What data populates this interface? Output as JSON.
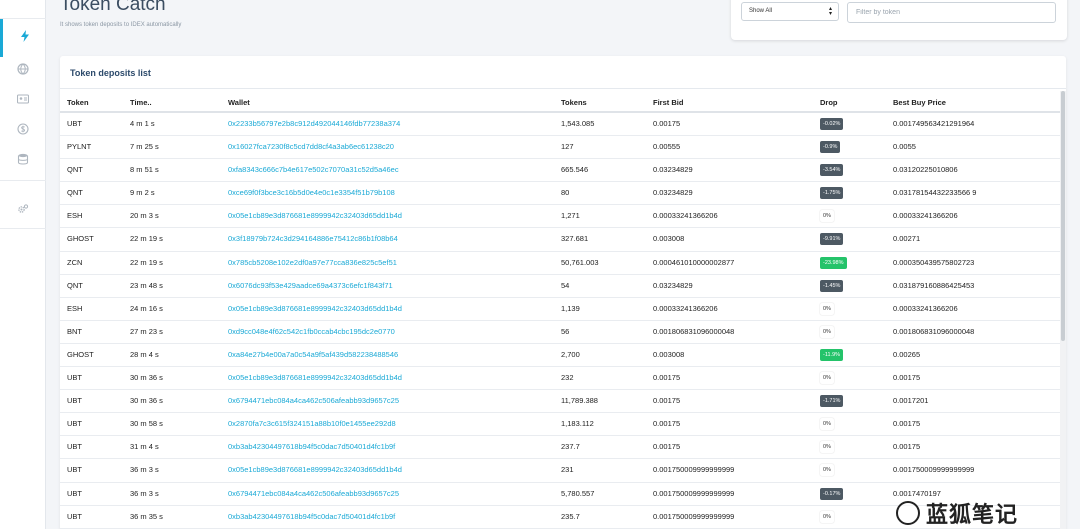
{
  "header": {
    "title": "Token Catch",
    "subtitle": "It shows token deposits to IDEX automatically"
  },
  "sidebar": {
    "items": [
      {
        "icon": "lightning-icon",
        "active": true
      },
      {
        "icon": "globe-icon",
        "active": false
      },
      {
        "icon": "id-card-icon",
        "active": false
      },
      {
        "icon": "dollar-circle-icon",
        "active": false
      },
      {
        "icon": "database-icon",
        "active": false
      },
      {
        "icon": "settings-icon",
        "active": false
      }
    ]
  },
  "filters": {
    "select_value": "Show All",
    "filter_placeholder": "Filter by token"
  },
  "card": {
    "title": "Token deposits list"
  },
  "table": {
    "columns": [
      "Token",
      "Time..",
      "Wallet",
      "Tokens",
      "First Bid",
      "Drop",
      "Best Buy Price"
    ],
    "rows": [
      {
        "token": "UBT",
        "time": "4 m 1 s",
        "wallet": "0x2233b56797e2b8c912d492044146fdb77238a374",
        "tokens": "1,543.085",
        "first_bid": "0.00175",
        "drop": "-0.02%",
        "drop_style": "dark",
        "best_buy": "0.001749563421291964"
      },
      {
        "token": "PYLNT",
        "time": "7 m 25 s",
        "wallet": "0x16027fca7230f8c5cd7dd8cf4a3ab6ec61238c20",
        "tokens": "127",
        "first_bid": "0.00555",
        "drop": "-0.9%",
        "drop_style": "dark",
        "best_buy": "0.0055"
      },
      {
        "token": "QNT",
        "time": "8 m 51 s",
        "wallet": "0xfa8343c666c7b4e617e502c7070a31c52d5a46ec",
        "tokens": "665.546",
        "first_bid": "0.03234829",
        "drop": "-3.54%",
        "drop_style": "dark",
        "best_buy": "0.03120225010806"
      },
      {
        "token": "QNT",
        "time": "9 m 2 s",
        "wallet": "0xce69f0f3bce3c16b5d0e4e0c1e3354f51b79b108",
        "tokens": "80",
        "first_bid": "0.03234829",
        "drop": "-1.75%",
        "drop_style": "dark",
        "best_buy": "0.03178154432233566 9"
      },
      {
        "token": "ESH",
        "time": "20 m 3 s",
        "wallet": "0x05e1cb89e3d876681e8999942c32403d65dd1b4d",
        "tokens": "1,271",
        "first_bid": "0.00033241366206",
        "drop": "0%",
        "drop_style": "plain",
        "best_buy": "0.00033241366206"
      },
      {
        "token": "GHOST",
        "time": "22 m 19 s",
        "wallet": "0x3f18979b724c3d294164886e75412c86b1f08b64",
        "tokens": "327.681",
        "first_bid": "0.003008",
        "drop": "-9.91%",
        "drop_style": "dark",
        "best_buy": "0.00271"
      },
      {
        "token": "ZCN",
        "time": "22 m 19 s",
        "wallet": "0x785cb5208e102e2df0a97e77cca836e825c5ef51",
        "tokens": "50,761.003",
        "first_bid": "0.000461010000002877",
        "drop": "-23.98%",
        "drop_style": "green",
        "best_buy": "0.000350439575802723"
      },
      {
        "token": "QNT",
        "time": "23 m 48 s",
        "wallet": "0x6076dc93f53e429aadce69a4373c6efc1f843f71",
        "tokens": "54",
        "first_bid": "0.03234829",
        "drop": "-1.45%",
        "drop_style": "dark",
        "best_buy": "0.031879160886425453"
      },
      {
        "token": "ESH",
        "time": "24 m 16 s",
        "wallet": "0x05e1cb89e3d876681e8999942c32403d65dd1b4d",
        "tokens": "1,139",
        "first_bid": "0.00033241366206",
        "drop": "0%",
        "drop_style": "plain",
        "best_buy": "0.00033241366206"
      },
      {
        "token": "BNT",
        "time": "27 m 23 s",
        "wallet": "0xd9cc048e4f62c542c1fb0ccab4cbc195dc2e0770",
        "tokens": "56",
        "first_bid": "0.001806831096000048",
        "drop": "0%",
        "drop_style": "plain",
        "best_buy": "0.001806831096000048"
      },
      {
        "token": "GHOST",
        "time": "28 m 4 s",
        "wallet": "0xa84e27b4e00a7a0c54a9f5af439d582238488546",
        "tokens": "2,700",
        "first_bid": "0.003008",
        "drop": "-11.9%",
        "drop_style": "green",
        "best_buy": "0.00265"
      },
      {
        "token": "UBT",
        "time": "30 m 36 s",
        "wallet": "0x05e1cb89e3d876681e8999942c32403d65dd1b4d",
        "tokens": "232",
        "first_bid": "0.00175",
        "drop": "0%",
        "drop_style": "plain",
        "best_buy": "0.00175"
      },
      {
        "token": "UBT",
        "time": "30 m 36 s",
        "wallet": "0x6794471ebc084a4ca462c506afeabb93d9657c25",
        "tokens": "11,789.388",
        "first_bid": "0.00175",
        "drop": "-1.71%",
        "drop_style": "dark",
        "best_buy": "0.0017201"
      },
      {
        "token": "UBT",
        "time": "30 m 58 s",
        "wallet": "0x2870fa7c3c615f324151a88b10f0e1455ee292d8",
        "tokens": "1,183.112",
        "first_bid": "0.00175",
        "drop": "0%",
        "drop_style": "plain",
        "best_buy": "0.00175"
      },
      {
        "token": "UBT",
        "time": "31 m 4 s",
        "wallet": "0xb3ab42304497618b94f5c0dac7d50401d4fc1b9f",
        "tokens": "237.7",
        "first_bid": "0.00175",
        "drop": "0%",
        "drop_style": "plain",
        "best_buy": "0.00175"
      },
      {
        "token": "UBT",
        "time": "36 m 3 s",
        "wallet": "0x05e1cb89e3d876681e8999942c32403d65dd1b4d",
        "tokens": "231",
        "first_bid": "0.001750009999999999",
        "drop": "0%",
        "drop_style": "plain",
        "best_buy": "0.001750009999999999"
      },
      {
        "token": "UBT",
        "time": "36 m 3 s",
        "wallet": "0x6794471ebc084a4ca462c506afeabb93d9657c25",
        "tokens": "5,780.557",
        "first_bid": "0.001750009999999999",
        "drop": "-0.17%",
        "drop_style": "dark",
        "best_buy": "0.0017470197"
      },
      {
        "token": "UBT",
        "time": "36 m 35 s",
        "wallet": "0xb3ab42304497618b94f5c0dac7d50401d4fc1b9f",
        "tokens": "235.7",
        "first_bid": "0.001750009999999999",
        "drop": "0%",
        "drop_style": "plain",
        "best_buy": ""
      }
    ]
  },
  "watermark": {
    "text": "蓝狐笔记"
  }
}
